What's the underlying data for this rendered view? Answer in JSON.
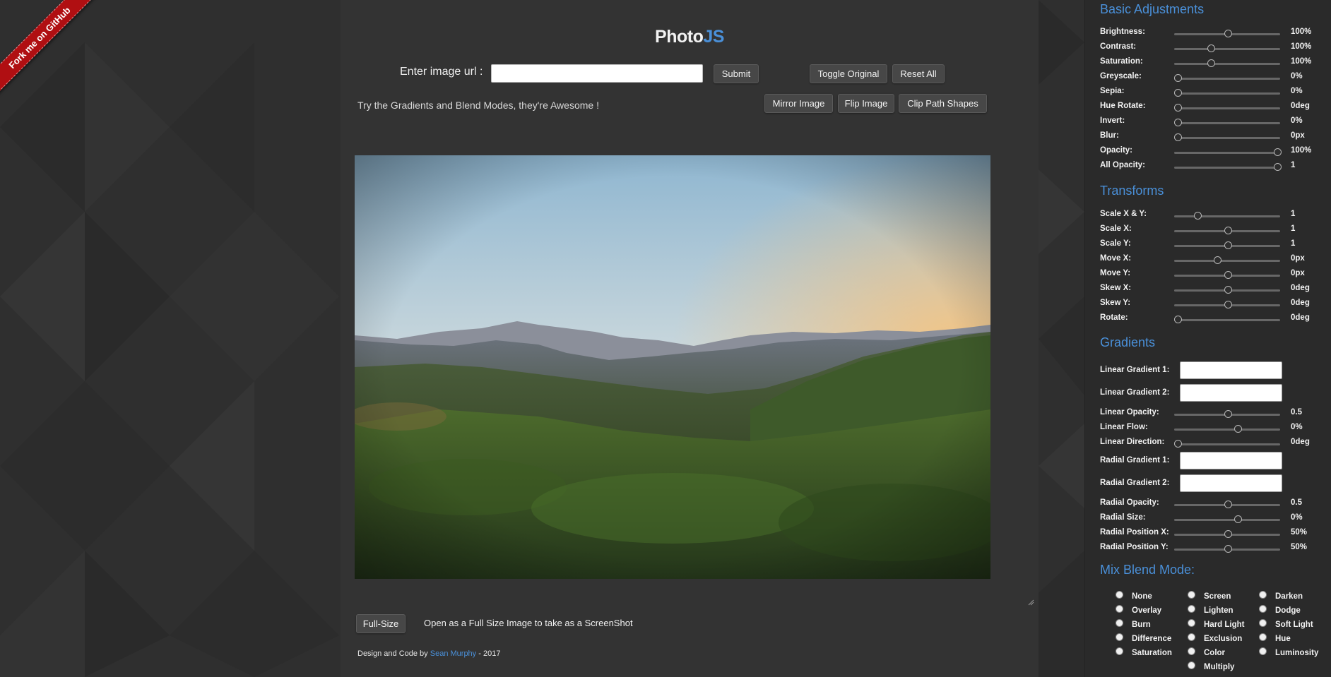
{
  "ribbon": {
    "label": "Fork me on GitHub"
  },
  "header": {
    "logo_part1": "Photo",
    "logo_part2": "JS"
  },
  "url_bar": {
    "label": "Enter image url :",
    "value": "",
    "placeholder": "",
    "submit_label": "Submit"
  },
  "toolbar": {
    "toggle_original_label": "Toggle Original",
    "reset_all_label": "Reset All",
    "mirror_label": "Mirror Image",
    "flip_label": "Flip Image",
    "clip_path_label": "Clip Path Shapes"
  },
  "tagline": "Try the Gradients and Blend Modes, they're Awesome !",
  "fullsize": {
    "button_label": "Full-Size",
    "description": "Open as a Full Size Image to take as a ScreenShot"
  },
  "credit": {
    "prefix": "Design and Code by",
    "author": "Sean Murphy",
    "suffix": "- 2017"
  },
  "sidebar": {
    "basic": {
      "title": "Basic Adjustments",
      "rows": [
        {
          "label": "Brightness:",
          "value": "100%",
          "level": 0.5
        },
        {
          "label": "Contrast:",
          "value": "100%",
          "level": 0.33
        },
        {
          "label": "Saturation:",
          "value": "100%",
          "level": 0.33
        },
        {
          "label": "Greyscale:",
          "value": "0%",
          "level": 0
        },
        {
          "label": "Sepia:",
          "value": "0%",
          "level": 0
        },
        {
          "label": "Hue Rotate:",
          "value": "0deg",
          "level": 0
        },
        {
          "label": "Invert:",
          "value": "0%",
          "level": 0
        },
        {
          "label": "Blur:",
          "value": "0px",
          "level": 0
        },
        {
          "label": "Opacity:",
          "value": "100%",
          "level": 1
        },
        {
          "label": "All Opacity:",
          "value": "1",
          "level": 1
        }
      ]
    },
    "transforms": {
      "title": "Transforms",
      "rows": [
        {
          "label": "Scale X & Y:",
          "value": "1",
          "level": 0.2
        },
        {
          "label": "Scale X:",
          "value": "1",
          "level": 0.5
        },
        {
          "label": "Scale Y:",
          "value": "1",
          "level": 0.5
        },
        {
          "label": "Move X:",
          "value": "0px",
          "level": 0.4
        },
        {
          "label": "Move Y:",
          "value": "0px",
          "level": 0.5
        },
        {
          "label": "Skew X:",
          "value": "0deg",
          "level": 0.5
        },
        {
          "label": "Skew Y:",
          "value": "0deg",
          "level": 0.5
        },
        {
          "label": "Rotate:",
          "value": "0deg",
          "level": 0
        }
      ]
    },
    "gradients": {
      "title": "Gradients",
      "rows": [
        {
          "label": "Linear Gradient 1:",
          "kind": "color"
        },
        {
          "label": "Linear Gradient 2:",
          "kind": "color"
        },
        {
          "label": "Linear Opacity:",
          "value": "0.5",
          "level": 0.5,
          "kind": "slider"
        },
        {
          "label": "Linear Flow:",
          "value": "0%",
          "level": 0.6,
          "kind": "slider"
        },
        {
          "label": "Linear Direction:",
          "value": "0deg",
          "level": 0,
          "kind": "slider"
        },
        {
          "label": "Radial Gradient 1:",
          "kind": "color"
        },
        {
          "label": "Radial Gradient 2:",
          "kind": "color"
        },
        {
          "label": "Radial Opacity:",
          "value": "0.5",
          "level": 0.5,
          "kind": "slider"
        },
        {
          "label": "Radial Size:",
          "value": "0%",
          "level": 0.6,
          "kind": "slider"
        },
        {
          "label": "Radial Position X:",
          "value": "50%",
          "level": 0.5,
          "kind": "slider"
        },
        {
          "label": "Radial Position Y:",
          "value": "50%",
          "level": 0.5,
          "kind": "slider"
        }
      ]
    },
    "blend": {
      "title": "Mix Blend Mode:",
      "columns": [
        [
          "None",
          "Overlay",
          "Burn",
          "Difference",
          "Saturation"
        ],
        [
          "Screen",
          "Lighten",
          "Hard Light",
          "Exclusion",
          "Color",
          "Multiply"
        ],
        [
          "Darken",
          "Dodge",
          "Soft Light",
          "Hue",
          "Luminosity"
        ]
      ]
    }
  },
  "colors": {
    "accent": "#4a90d9",
    "ribbon": "#b00f12",
    "main_bg": "#333333",
    "sidebar_bg": "#2a2a2a",
    "page_bg": "#2f2f2f"
  },
  "icons": {
    "resize_grip": "resize-grip-icon"
  }
}
